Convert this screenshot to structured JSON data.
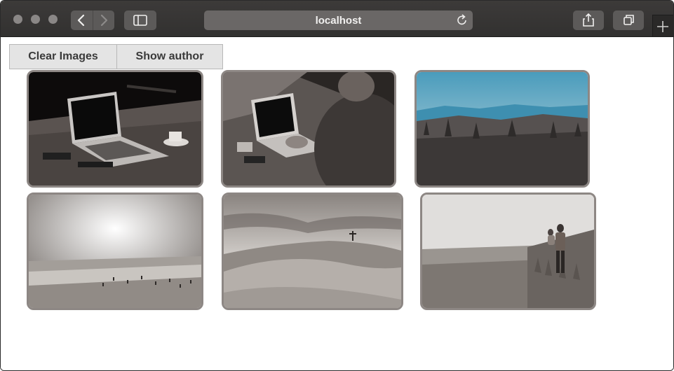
{
  "browser": {
    "url": "localhost",
    "icons": {
      "back": "chevron-left-icon",
      "forward": "chevron-right-icon",
      "sidebar": "sidebar-icon",
      "reload": "reload-icon",
      "share": "share-icon",
      "tabs": "tabs-icon",
      "new_tab": "plus-icon"
    }
  },
  "toolbar": {
    "clear_label": "Clear Images",
    "author_label": "Show author"
  },
  "gallery": {
    "images": [
      {
        "subject": "laptop on desk"
      },
      {
        "subject": "person typing on laptop"
      },
      {
        "subject": "hills under blue sky"
      },
      {
        "subject": "beach with people"
      },
      {
        "subject": "sand dunes with cross"
      },
      {
        "subject": "man carrying child on field"
      }
    ]
  },
  "colors": {
    "titlebar": "#363433",
    "button_bg": "#e4e4e4",
    "photo_border": "#8d8784"
  }
}
